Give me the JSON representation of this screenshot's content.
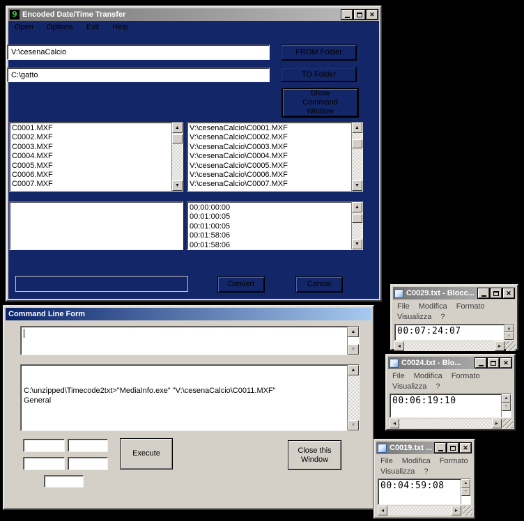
{
  "main_window": {
    "title": "Encoded Date/Time Transfer",
    "icon_glyph": "9",
    "menu": [
      "Open",
      "Options",
      "Exit",
      "Help"
    ],
    "from_field": "V:\\cesenaCalcio",
    "to_field": "C:\\gatto",
    "from_button": "FROM Folder",
    "to_button": "TO Folder",
    "show_command_button": "Show Command Window",
    "convert_button": "Convert",
    "cancel_button": "Cancel",
    "files": [
      "C0001.MXF",
      "C0002.MXF",
      "C0003.MXF",
      "C0004.MXF",
      "C0005.MXF",
      "C0006.MXF",
      "C0007.MXF"
    ],
    "full_paths": [
      "V:\\cesenaCalcio\\C0001.MXF",
      "V:\\cesenaCalcio\\C0002.MXF",
      "V:\\cesenaCalcio\\C0003.MXF",
      "V:\\cesenaCalcio\\C0004.MXF",
      "V:\\cesenaCalcio\\C0005.MXF",
      "V:\\cesenaCalcio\\C0006.MXF",
      "V:\\cesenaCalcio\\C0007.MXF"
    ],
    "timecodes": [
      "00:00:00:00",
      "00:01:00:05",
      "00:01:00:05",
      "00:01:58:06",
      "00:01:58:06"
    ]
  },
  "command_window": {
    "title": "Command Line Form",
    "input_value": "",
    "output_line1": "C:\\unzipped\\Timecode2txt>\"MediaInfo.exe\" \"V:\\cesenaCalcio\\C0011.MXF\"",
    "output_line2": "General",
    "execute_button": "Execute",
    "close_button": "Close this Window"
  },
  "notepad_windows": [
    {
      "title": "C0029.txt - Blocc...",
      "menu": [
        "File",
        "Modifica",
        "Formato",
        "Visualizza",
        "?"
      ],
      "content": "00:07:24:07"
    },
    {
      "title": "C0024.txt - Blo...",
      "menu": [
        "File",
        "Modifica",
        "Formato",
        "Visualizza",
        "?"
      ],
      "content": "00:06:19:10"
    },
    {
      "title": "C0019.txt ...",
      "menu": [
        "File",
        "Modifica",
        "Formato",
        "Visualizza",
        "?"
      ],
      "content": "00:04:59:08"
    }
  ],
  "colors": {
    "desktop": "#000000",
    "navy_client": "#132668",
    "chrome_gray": "#d4d0c8",
    "active_title_start": "#0a246a",
    "active_title_end": "#a6caf0",
    "inactive_title_start": "#757575",
    "inactive_title_end": "#bdbdbd",
    "app_icon_green": "#35c435"
  }
}
